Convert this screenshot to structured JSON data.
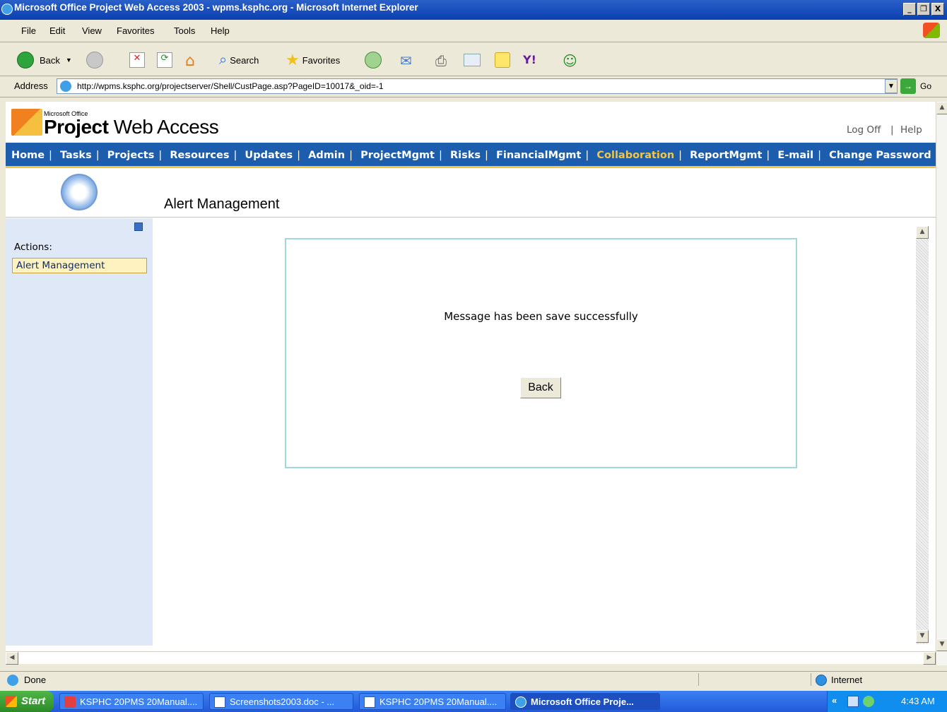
{
  "window": {
    "title": "Microsoft Office Project Web Access 2003 - wpms.ksphc.org - Microsoft Internet Explorer",
    "buttons": [
      "_",
      "❐",
      "X"
    ]
  },
  "menu": [
    "File",
    "Edit",
    "View",
    "Favorites",
    "Tools",
    "Help"
  ],
  "toolbar": {
    "back": "Back",
    "search": "Search",
    "favorites": "Favorites"
  },
  "address": {
    "label": "Address",
    "url": "http://wpms.ksphc.org/projectserver/Shell/CustPage.asp?PageID=10017&_oid=-1",
    "go": "Go"
  },
  "app": {
    "brand_small": "Microsoft Office",
    "brand_bold": "Project",
    "brand_rest": " Web Access",
    "log_off": "Log Off",
    "help": "Help",
    "sep": "|",
    "nav": [
      "Home",
      "Tasks",
      "Projects",
      "Resources",
      "Updates",
      "Admin",
      "ProjectMgmt",
      "Risks",
      "FinancialMgmt",
      "Collaboration",
      "ReportMgmt",
      "E-mail",
      "Change Password"
    ],
    "active_nav": "Collaboration",
    "page_title": "Alert Management",
    "actions_label": "Actions:",
    "action_item": "Alert Management",
    "message": "Message has been save successfully",
    "back_button": "Back"
  },
  "status": {
    "text": "Done",
    "zone": "Internet"
  },
  "taskbar": {
    "start": "Start",
    "tasks": [
      "KSPHC 20PMS 20Manual....",
      "Screenshots2003.doc - ...",
      "KSPHC 20PMS 20Manual....",
      "Microsoft Office Proje..."
    ],
    "clock": "4:43 AM",
    "tray_arrow": "«"
  },
  "colors": {
    "nav_bg": "#1c5dad",
    "nav_active": "#f4c542",
    "sidebar_bg": "#dfe8f6",
    "msgbox_border": "#a0d8dc"
  }
}
